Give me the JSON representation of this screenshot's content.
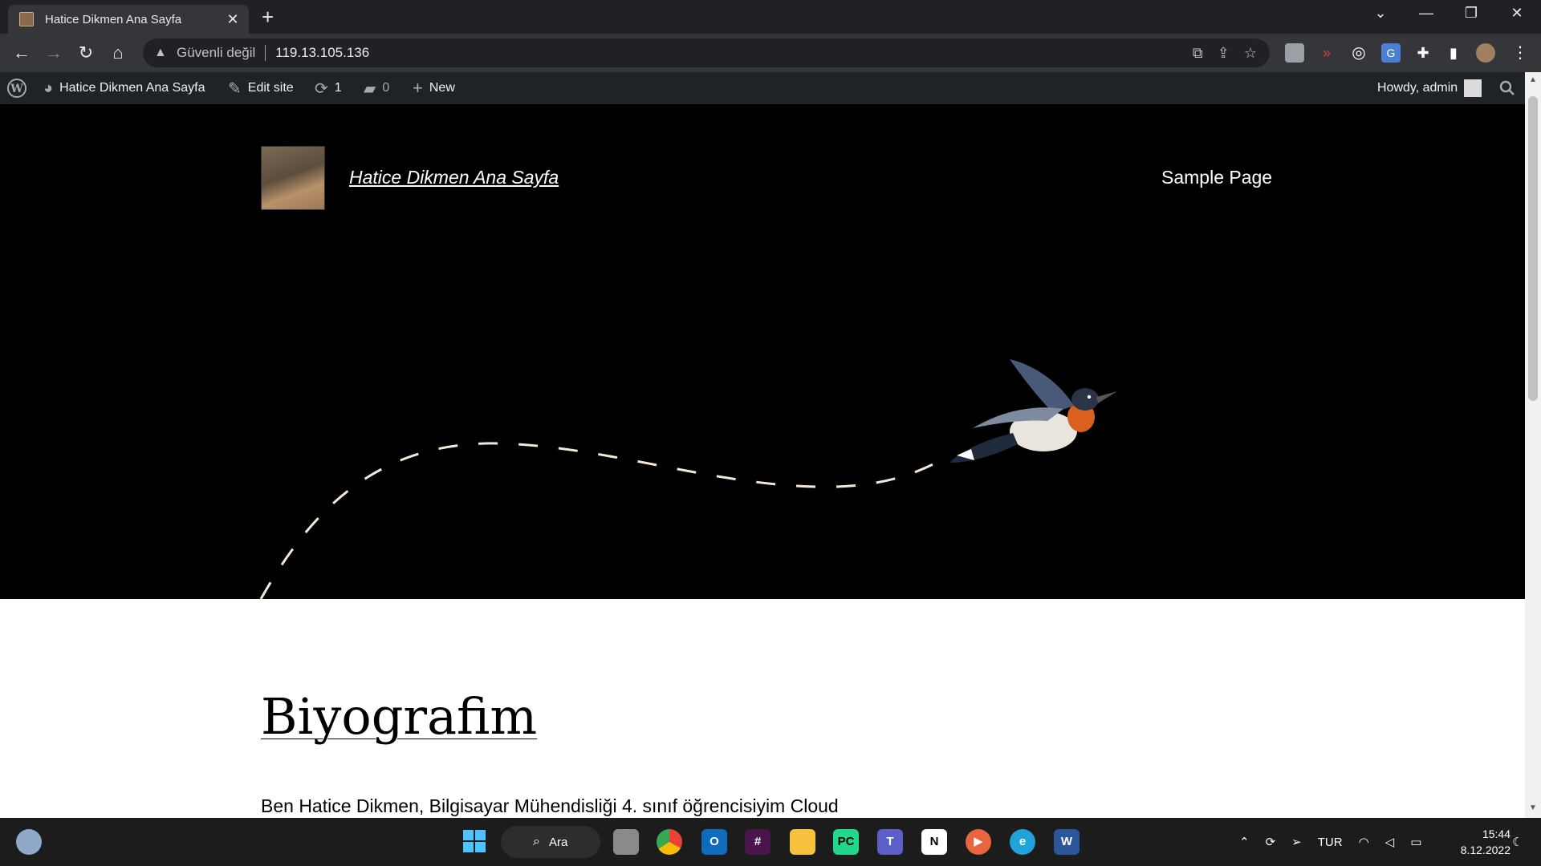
{
  "browser": {
    "tab_title": "Hatice Dikmen Ana Sayfa",
    "insecure_label": "Güvenli değil",
    "url": "119.13.105.136"
  },
  "adminbar": {
    "site_name": "Hatice Dikmen Ana Sayfa",
    "edit_site": "Edit site",
    "updates_count": "1",
    "comments_count": "0",
    "new_label": "New",
    "howdy": "Howdy, admin"
  },
  "site": {
    "title": "Hatice Dikmen Ana Sayfa",
    "nav_sample_page": "Sample Page"
  },
  "post": {
    "title": "Biyografim",
    "excerpt": "Ben Hatice Dikmen, Bilgisayar Mühendisliği 4. sınıf öğrencisiyim Cloud"
  },
  "taskbar": {
    "search_label": "Ara",
    "language": "TUR",
    "time": "15:44",
    "date": "8.12.2022"
  },
  "icons": {
    "back": "back-arrow-icon",
    "forward": "forward-arrow-icon",
    "reload": "reload-icon",
    "home": "home-icon",
    "wordpress": "wordpress-logo-icon",
    "search": "search-icon"
  },
  "colors": {
    "adminbar_bg": "#1d2327",
    "chrome_dark": "#202124",
    "taskbar_bg": "#1c1c1c",
    "dash_color": "#f4e9d8"
  }
}
